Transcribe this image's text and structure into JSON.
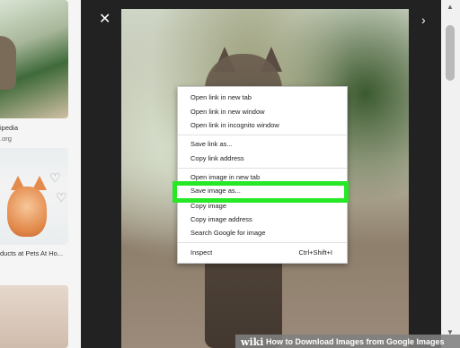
{
  "left_results": {
    "result_1": {
      "source": "ipedia",
      "domain": ".org"
    },
    "result_2": {
      "title": "ducts at Pets At Ho..."
    }
  },
  "viewer": {
    "close_icon": "✕",
    "prev_icon": "‹",
    "next_icon": "›"
  },
  "scrollbar": {
    "up_icon": "▲",
    "down_icon": "▼"
  },
  "context_menu": {
    "items": [
      "Open link in new tab",
      "Open link in new window",
      "Open link in incognito window",
      "Save link as...",
      "Copy link address",
      "Open image in new tab",
      "Save image as...",
      "Copy image",
      "Copy image address",
      "Search Google for image",
      "Inspect"
    ],
    "inspect_shortcut": "Ctrl+Shift+I",
    "highlight_color": "#27e827"
  },
  "footer": {
    "logo_text": "wiki",
    "title": "How to Download Images from Google Images"
  }
}
